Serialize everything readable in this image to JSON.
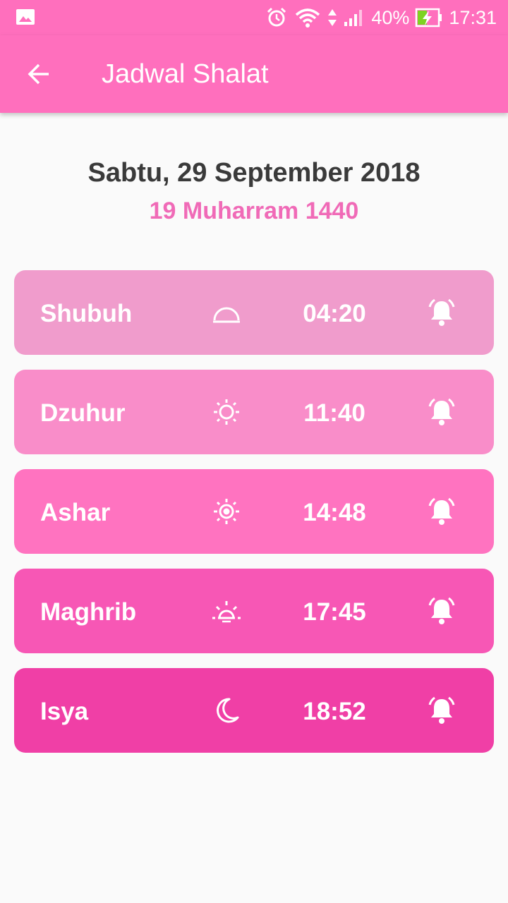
{
  "status_bar": {
    "battery": "40%",
    "time": "17:31",
    "icons": [
      "image-icon",
      "alarm-clock-icon",
      "wifi-icon",
      "signal-icon",
      "battery-charging-icon"
    ]
  },
  "app_bar": {
    "title": "Jadwal Shalat",
    "back_icon": "arrow-back-icon",
    "color": "#ff6fbd"
  },
  "dates": {
    "gregorian": "Sabtu, 29 September 2018",
    "hijri": "19 Muharram 1440",
    "hijri_color": "#f06ab7"
  },
  "prayers": [
    {
      "name": "Shubuh",
      "time": "04:20",
      "icon": "dawn-icon",
      "color": "#f09ccc",
      "alarm_icon": "alarm-bell-icon"
    },
    {
      "name": "Dzuhur",
      "time": "11:40",
      "icon": "sun-icon",
      "color": "#f98dc9",
      "alarm_icon": "alarm-bell-icon"
    },
    {
      "name": "Ashar",
      "time": "14:48",
      "icon": "sun-bright-icon",
      "color": "#ff73c0",
      "alarm_icon": "alarm-bell-icon"
    },
    {
      "name": "Maghrib",
      "time": "17:45",
      "icon": "sunset-icon",
      "color": "#f757b5",
      "alarm_icon": "alarm-bell-icon"
    },
    {
      "name": "Isya",
      "time": "18:52",
      "icon": "moon-icon",
      "color": "#f03fa6",
      "alarm_icon": "alarm-bell-icon"
    }
  ]
}
